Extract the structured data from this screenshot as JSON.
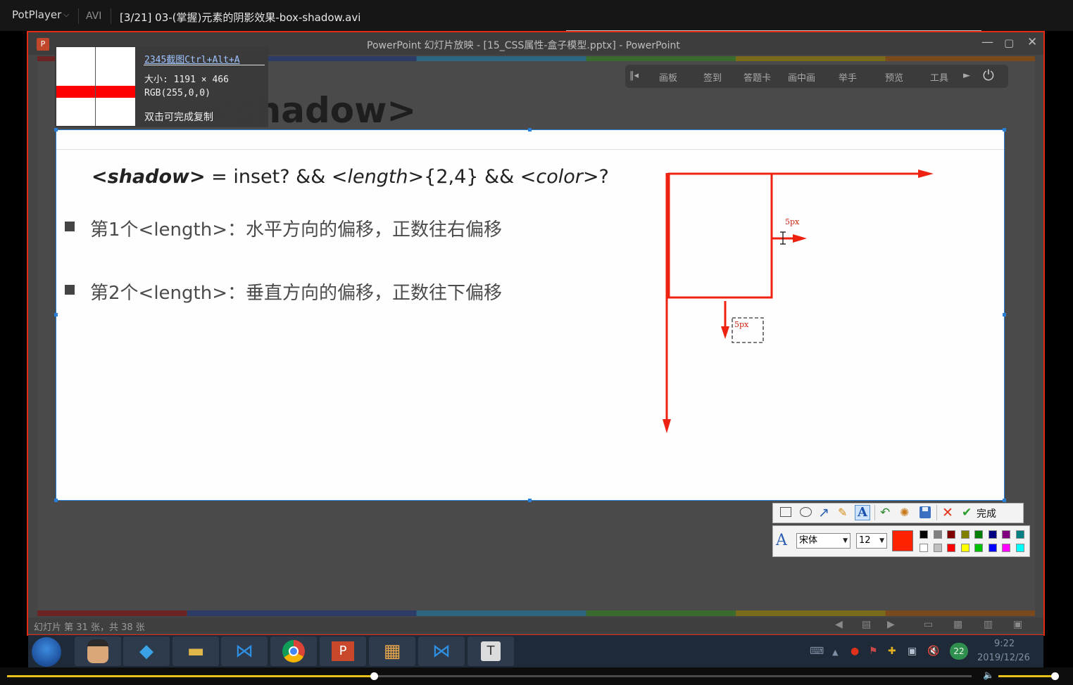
{
  "player": {
    "app_name": "PotPlayer",
    "caret": "⌵",
    "format": "AVI",
    "file_title": "[3/21] 03-(掌握)元素的阴影效果-box-shadow.avi",
    "seek_progress": 0.38,
    "volume_level": 0.93
  },
  "ppt": {
    "icon_label": "P",
    "window_title": "PowerPoint 幻灯片放映 - [15_CSS属性-盒子模型.pptx] - PowerPoint",
    "min_glyph": "—",
    "max_glyph": "▢",
    "close_glyph": "✕",
    "slide_heading": "<shadow>",
    "status_text": "幻灯片 第 31 张，共 38 张"
  },
  "class_toolbar": {
    "items": [
      "画板",
      "签到",
      "答题卡",
      "画中画",
      "举手",
      "预览",
      "工具"
    ],
    "prev_glyph": "‖◂",
    "next_glyph": "►",
    "power_glyph": "⏻"
  },
  "snip": {
    "hotkey": "2345截图Ctrl+Alt+A",
    "size": "大小: 1191 × 466",
    "rgb": "RGB(255,0,0)",
    "hint": "双击可完成复制",
    "pixel_color": "#ff0000"
  },
  "slide": {
    "formula": {
      "shadow": "<shadow>",
      "eq": " = inset? && ",
      "length": "<length>",
      "rep": "{2,4} && ",
      "color": "<color>",
      "q": "?"
    },
    "bullets": [
      "第1个<length>：水平方向的偏移，正数往右偏移",
      "第2个<length>：垂直方向的偏移，正数往下偏移"
    ],
    "diagram": {
      "label_right": "5px",
      "label_down": "5px",
      "stroke_color": "#ee2211"
    }
  },
  "draw_toolbar": {
    "done_label": "完成",
    "font_name": "宋体",
    "font_size": "12",
    "current_color": "#ff2200",
    "text_icon": "A",
    "palette_top": [
      "#000000",
      "#808080",
      "#800000",
      "#808000",
      "#008000",
      "#000080",
      "#800080",
      "#008080"
    ],
    "palette_bottom": [
      "#ffffff",
      "#c0c0c0",
      "#ff0000",
      "#ffff00",
      "#00c000",
      "#0000ff",
      "#ff00ff",
      "#00ffff"
    ]
  },
  "taskbar": {
    "time": "9:22",
    "date": "2019/12/26",
    "notification_count": "22"
  }
}
